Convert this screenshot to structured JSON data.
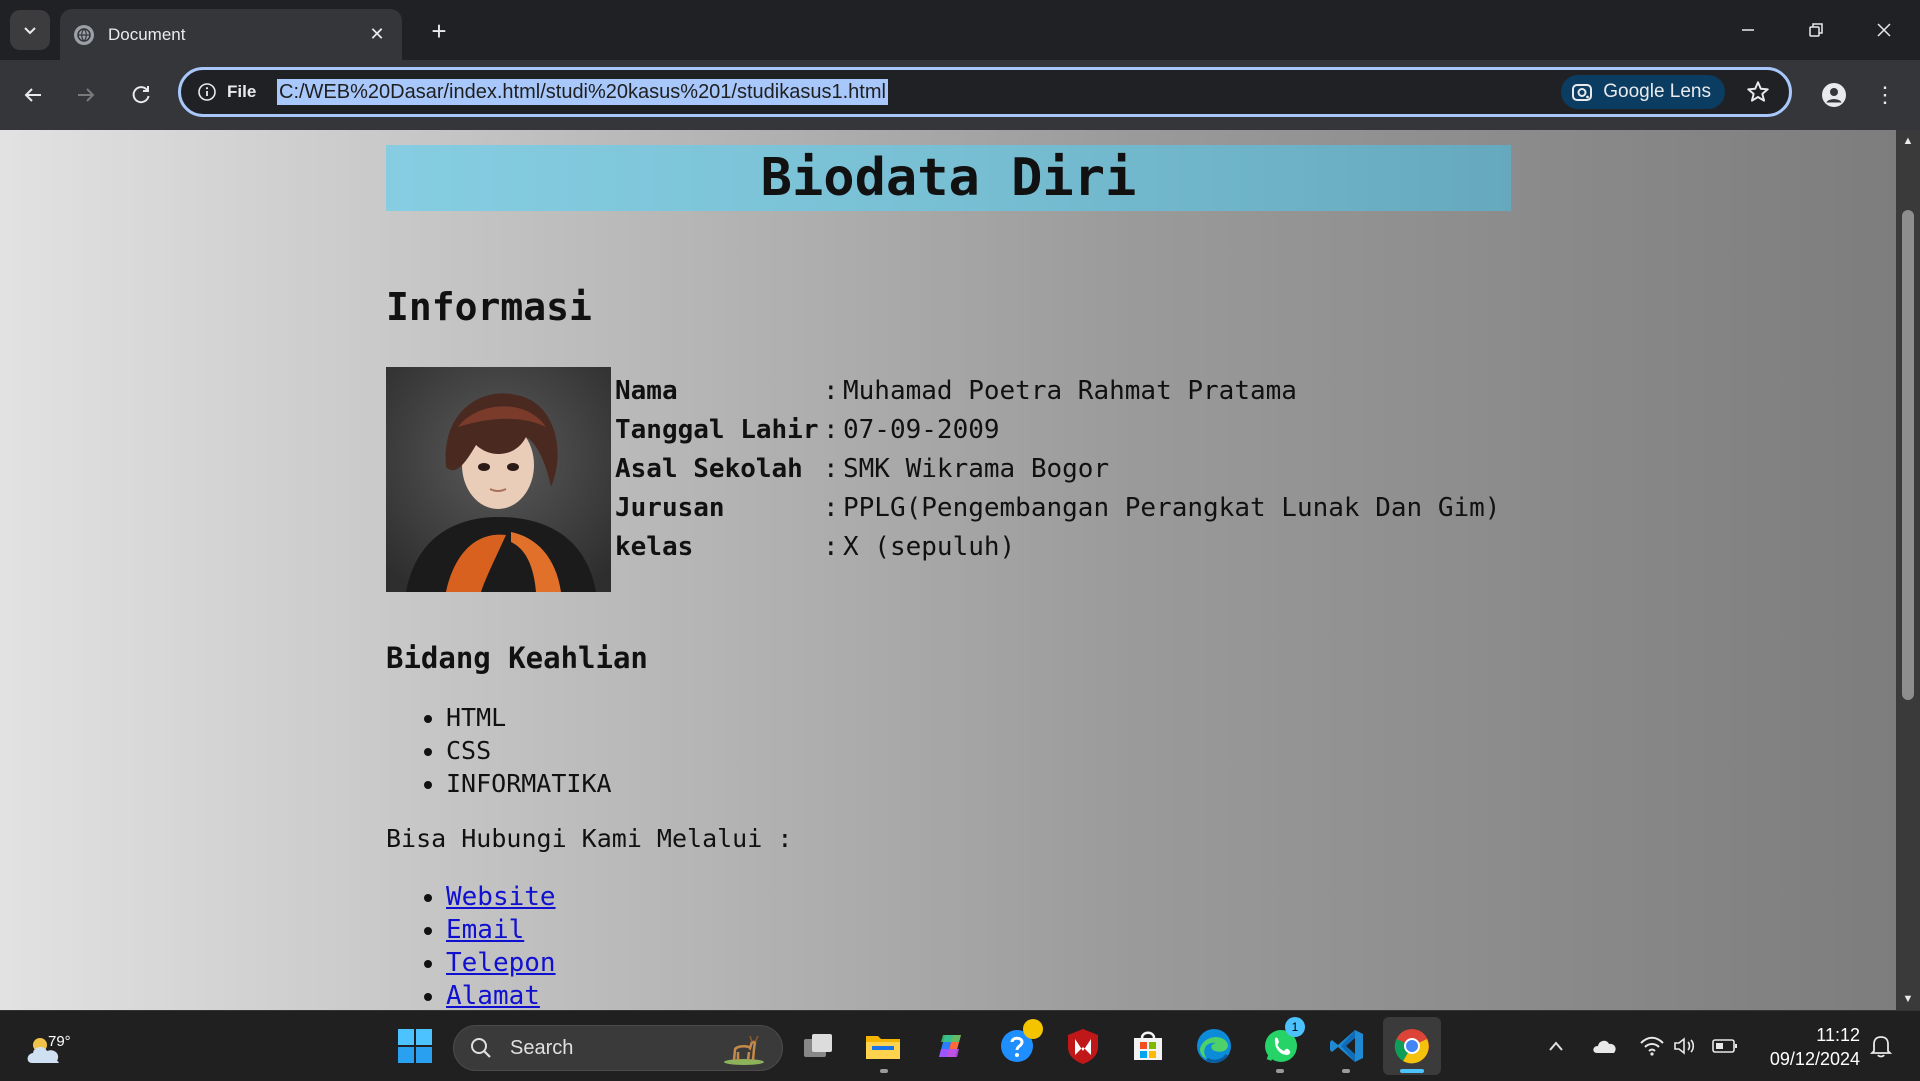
{
  "browser": {
    "tab_title": "Document",
    "url_scheme_label": "File",
    "url": "C:/WEB%20Dasar/index.html/studi%20kasus%201/studikasus1.html",
    "lens_label": "Google Lens",
    "accent_color": "#a8c7fa"
  },
  "page": {
    "banner_title": "Biodata Diri",
    "section_title": "Informasi",
    "info_rows": [
      {
        "label": "Nama",
        "colon": ":",
        "value": "Muhamad Poetra Rahmat Pratama"
      },
      {
        "label": "Tanggal Lahir",
        "colon": ":",
        "value": "07-09-2009"
      },
      {
        "label": "Asal Sekolah",
        "colon": ":",
        "value": "SMK Wikrama Bogor"
      },
      {
        "label": "Jurusan",
        "colon": ":",
        "value": "PPLG(Pengembangan Perangkat Lunak Dan Gim)"
      },
      {
        "label": "kelas",
        "colon": ":",
        "value": "X (sepuluh)"
      }
    ],
    "skills_title": "Bidang Keahlian",
    "skills": [
      "HTML",
      "CSS",
      "INFORMATIKA"
    ],
    "contact_text": "Bisa Hubungi Kami Melalui :",
    "contact_links": [
      "Website",
      "Email",
      "Telepon",
      "Alamat"
    ],
    "banner_color": "#7fc6dc",
    "link_color": "#1010d0"
  },
  "taskbar": {
    "weather_temp": "79°",
    "search_placeholder": "Search",
    "whatsapp_badge": "1",
    "time": "11:12",
    "date": "09/12/2024"
  }
}
